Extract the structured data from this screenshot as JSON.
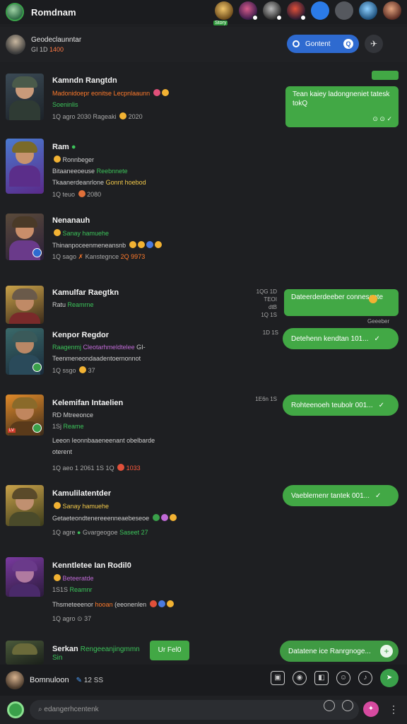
{
  "topbar": {
    "title": "Romdnam",
    "story_tag": "Story",
    "stories": [
      "story-1",
      "story-2",
      "story-3",
      "story-4",
      "story-5",
      "story-6",
      "story-7",
      "story-8"
    ]
  },
  "chat_header": {
    "name": "Geodeclaunntar",
    "meta_prefix": "GI 1D",
    "meta_highlight": "1400",
    "search_label": "Gontent",
    "search_badge": "Q"
  },
  "chats": [
    {
      "name": "Kamndn Rangtdn",
      "line1": "Madonidoepr eonitse Lecpnlaaunn",
      "line2": "Soeninlis",
      "line3": "1Q agro 2030 Rageaki",
      "line3b": "2020",
      "bubble_text": "Tean kaiey ladongneniet tatesk",
      "bubble_meta": "tokQ",
      "checks": "⊙ ⊙ ✓"
    },
    {
      "name": "Ram",
      "line1": "Ronnbeger",
      "line2": "Bitaaneeoeuse",
      "line2b": "Reebnnete",
      "line3": "Tkaanerdeanrlone",
      "line3b": "Gonnt hoebod",
      "line4": "1Q teuo",
      "line4b": "2080"
    },
    {
      "name": "Nenanauh",
      "line1": "Sanay hamuehe",
      "line2": "Thinanpoceenmeneansnb",
      "line3": "1Q sago",
      "line3b": "Kanstegnce",
      "line3c": "2Q 9973"
    },
    {
      "name": "Kamulfar Raegtkn",
      "line1": "Ratu",
      "line1b": "Reamrne",
      "time_lines": [
        "1QG 1D",
        "TEOI",
        "dtB",
        "1Q 1S"
      ],
      "bubble_text": "Dateerderdeeber conneseote",
      "bubble_meta": "Geeeber",
      "checks": "✓"
    },
    {
      "name": "Kenpor Regdor",
      "line1": "Raagenmj",
      "line1b": "Cleotarhmeldtelee",
      "line1c": "GI-",
      "line2": "Teenmeneondaadentoernonnot",
      "line3": "1Q ssgo",
      "line3b": "37",
      "time": "1D 1S",
      "pill_text": "Detehenn kendtan 101..."
    },
    {
      "name": "Kelemifan Intaelien",
      "line1": "RD Mtreeonce",
      "line2": "1Sj",
      "line2b": "Reame",
      "line3": "Leeon Ieonnbaaeneenant obelbarde",
      "line3b": "oterent",
      "line4": "1Q aeo 1 2061 1S 1Q",
      "line4b": "1033",
      "time": "1E6n 1S",
      "pill_text": "Rohteenoeh teubolr 001..."
    },
    {
      "name": "Kamulilatentder",
      "line1": "Sanay hamuehe",
      "line2": "Getaeteondtenereeenneaebeseoe",
      "line3": "1Q agre",
      "line3b": "Gvargeogoe",
      "line3c": "Saseet 27",
      "pill_text": "Vaeblemenr tantek 001..."
    },
    {
      "name": "Kenntletee Ian Rodil0",
      "line1": "Beteeratde",
      "line2": "1S1S",
      "line2b": "Reamnr",
      "line3": "Thsmeteeenor",
      "line3b": "hooan",
      "line3c": "(eeonenlen",
      "line4": "1Q agro",
      "line4b": "37"
    },
    {
      "name": "Serkan",
      "line1": "Rengeeanjingmmn Sin",
      "tag": "Ur Fel0",
      "pill_text": "Datatene ice Ranrgnoge..."
    }
  ],
  "composer": {
    "name": "Bomnuloon",
    "count": "12 SS"
  },
  "input": {
    "placeholder": "edangerhcentenk"
  }
}
